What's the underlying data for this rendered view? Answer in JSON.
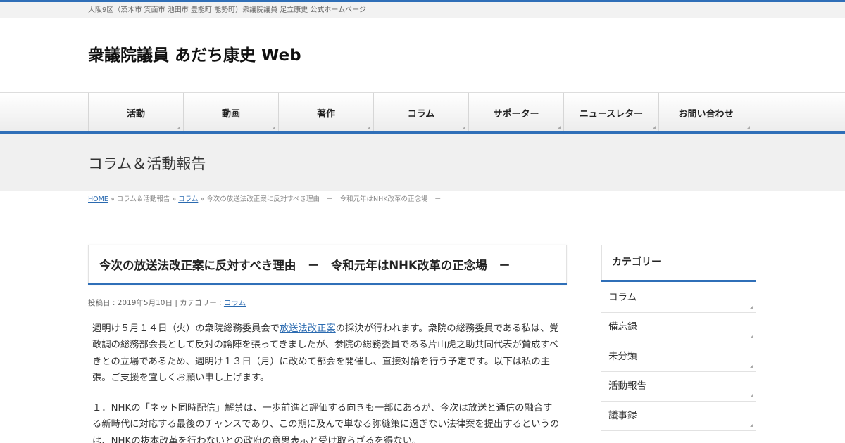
{
  "header": {
    "tagline": "大阪9区（茨木市 箕面市 池田市 豊能町 能勢町）衆議院議員 足立康史 公式ホームページ",
    "site_title": "衆議院議員 あだち康史 Web"
  },
  "nav": {
    "items": [
      {
        "label": "活動"
      },
      {
        "label": "動画"
      },
      {
        "label": "著作"
      },
      {
        "label": "コラム"
      },
      {
        "label": "サポーター"
      },
      {
        "label": "ニュースレター"
      },
      {
        "label": "お問い合わせ"
      }
    ]
  },
  "page_header": {
    "title": "コラム＆活動報告"
  },
  "breadcrumb": {
    "home": "HOME",
    "sep": "»",
    "section": "コラム＆活動報告",
    "category": "コラム",
    "current": "今次の放送法改正案に反対すべき理由　－　令和元年はNHK改革の正念場　－"
  },
  "post": {
    "title": "今次の放送法改正案に反対すべき理由　－　令和元年はNHK改革の正念場　－",
    "meta_prefix": "投稿日 : 2019年5月10日 | カテゴリー : ",
    "meta_category": "コラム",
    "p1_before": "週明け５月１４日（火）の衆院総務委員会で",
    "p1_link": "放送法改正案",
    "p1_after": "の採決が行われます。衆院の総務委員である私は、党政調の総務部会長として反対の論陣を張ってきましたが、参院の総務委員である片山虎之助共同代表が賛成すべきとの立場であるため、週明け１３日（月）に改めて部会を開催し、直接対論を行う予定です。以下は私の主張。ご支援を宜しくお願い申し上げます。",
    "p2": "１．NHKの「ネット同時配信」解禁は、一歩前進と評価する向きも一部にあるが、今次は放送と通信の融合する新時代に対応する最後のチャンスであり、この期に及んで単なる弥縫策に過ぎない法律案を提出するというのは、NHKの抜本改革を行わないとの政府の意思表示と受け取らざるを得ない。"
  },
  "sidebar": {
    "category_title": "カテゴリー",
    "categories": [
      {
        "label": "コラム"
      },
      {
        "label": "備忘録"
      },
      {
        "label": "未分類"
      },
      {
        "label": "活動報告"
      },
      {
        "label": "議事録"
      }
    ]
  },
  "colors": {
    "accent": "#2f6fb8",
    "link": "#2a6ab0"
  }
}
